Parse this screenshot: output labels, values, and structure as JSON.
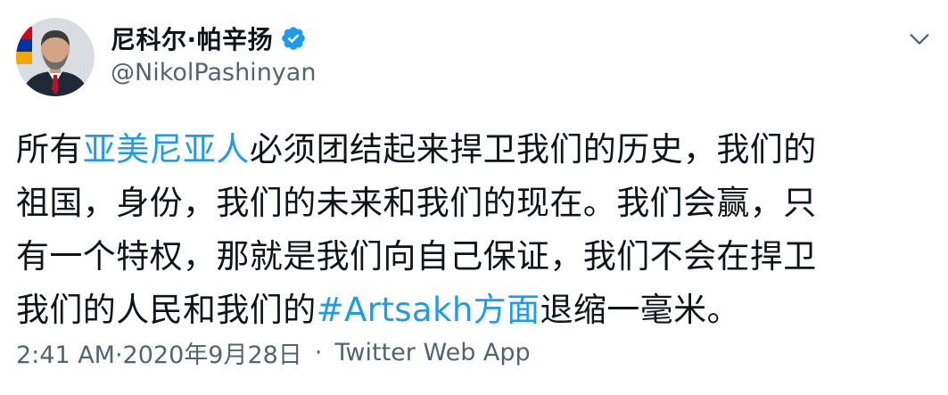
{
  "author": {
    "display_name": "尼科尔·帕辛扬",
    "handle": "@NikolPashinyan",
    "verified_icon": "verified-badge-icon"
  },
  "menu_icon": "chevron-down-icon",
  "tweet": {
    "line1_a": "所有",
    "line1_link": "亚美尼亚人",
    "line1_b": "必须团结起来捍卫我们的历史，我们的",
    "line2": "祖国，身份，我们的未来和我们的现在。我们会赢，只",
    "line3": "有一个特权，那就是我们向自己保证，我们不会在捍卫",
    "line4_a": "我们的人民和我们的",
    "line4_link": "#Artsakh方面",
    "line4_b": "退缩一毫米。"
  },
  "meta": {
    "timestamp": "2:41 AM·2020年9月28日",
    "separator": "·",
    "source": "Twitter Web App"
  },
  "colors": {
    "link": "#1d9bf0",
    "secondary_text": "#536471",
    "primary_text": "#0f1419"
  }
}
